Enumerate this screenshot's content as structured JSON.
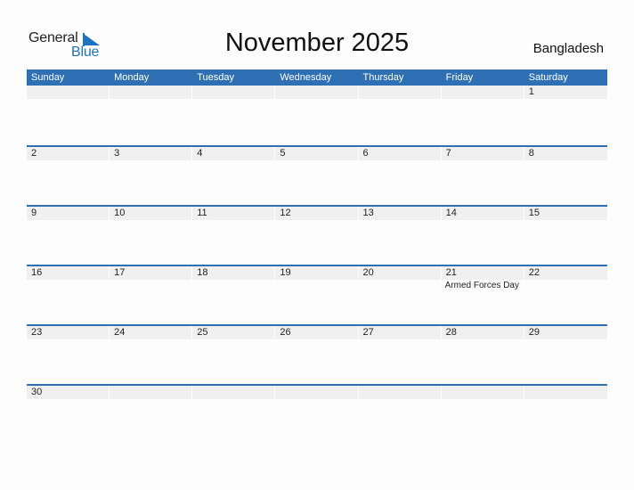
{
  "logo": {
    "word1": "General",
    "word2": "Blue"
  },
  "header": {
    "title": "November 2025",
    "country": "Bangladesh"
  },
  "colors": {
    "accent": "#2e70b3",
    "day_band": "#f0f0f0"
  },
  "weekdays": [
    "Sunday",
    "Monday",
    "Tuesday",
    "Wednesday",
    "Thursday",
    "Friday",
    "Saturday"
  ],
  "weeks": [
    [
      {
        "d": ""
      },
      {
        "d": ""
      },
      {
        "d": ""
      },
      {
        "d": ""
      },
      {
        "d": ""
      },
      {
        "d": ""
      },
      {
        "d": "1"
      }
    ],
    [
      {
        "d": "2"
      },
      {
        "d": "3"
      },
      {
        "d": "4"
      },
      {
        "d": "5"
      },
      {
        "d": "6"
      },
      {
        "d": "7"
      },
      {
        "d": "8"
      }
    ],
    [
      {
        "d": "9"
      },
      {
        "d": "10"
      },
      {
        "d": "11"
      },
      {
        "d": "12"
      },
      {
        "d": "13"
      },
      {
        "d": "14"
      },
      {
        "d": "15"
      }
    ],
    [
      {
        "d": "16"
      },
      {
        "d": "17"
      },
      {
        "d": "18"
      },
      {
        "d": "19"
      },
      {
        "d": "20"
      },
      {
        "d": "21",
        "event": "Armed Forces Day"
      },
      {
        "d": "22"
      }
    ],
    [
      {
        "d": "23"
      },
      {
        "d": "24"
      },
      {
        "d": "25"
      },
      {
        "d": "26"
      },
      {
        "d": "27"
      },
      {
        "d": "28"
      },
      {
        "d": "29"
      }
    ],
    [
      {
        "d": "30"
      },
      {
        "d": ""
      },
      {
        "d": ""
      },
      {
        "d": ""
      },
      {
        "d": ""
      },
      {
        "d": ""
      },
      {
        "d": ""
      }
    ]
  ]
}
